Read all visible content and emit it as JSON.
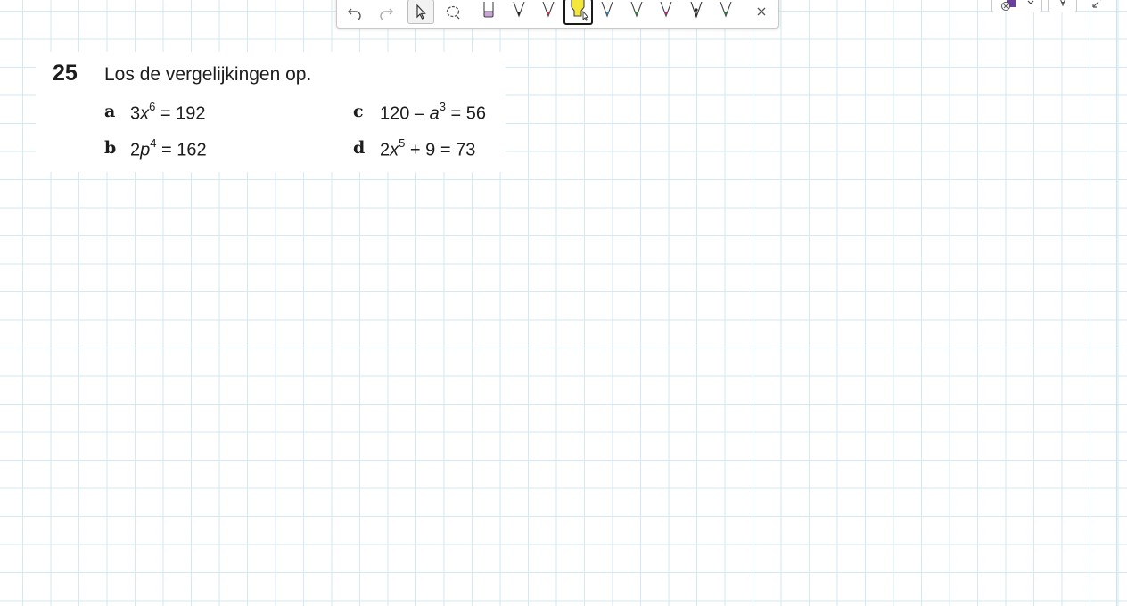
{
  "toolbar": {
    "tools": [
      {
        "name": "undo-icon"
      },
      {
        "name": "redo-icon"
      },
      {
        "name": "select-pointer-icon",
        "active": true
      },
      {
        "name": "lasso-icon"
      },
      {
        "name": "eraser-icon",
        "color": "#c9a3d9"
      },
      {
        "name": "pen-black-icon",
        "color": "#222222"
      },
      {
        "name": "pen-red-icon",
        "color": "#c8334a"
      },
      {
        "name": "highlighter-yellow-icon",
        "color": "#f5e63a",
        "selected": true
      },
      {
        "name": "pen-blue-icon",
        "color": "#2f7fb8"
      },
      {
        "name": "pen-green-icon",
        "color": "#2e8b3e"
      },
      {
        "name": "pen-magenta-icon",
        "color": "#b0288f"
      },
      {
        "name": "fountain-pen-icon",
        "color": "#222222"
      },
      {
        "name": "pen-darkgreen-icon",
        "color": "#2c7a46"
      },
      {
        "name": "close-icon"
      }
    ]
  },
  "exercise": {
    "number": "25",
    "instruction": "Los de vergelijkingen op.",
    "parts": [
      {
        "letter": "a",
        "coef": "3",
        "var": "x",
        "exp": "6",
        "rest": " = 192"
      },
      {
        "letter": "b",
        "coef": "2",
        "var": "p",
        "exp": "4",
        "rest": " = 162"
      },
      {
        "letter": "c",
        "pre": "120 – ",
        "var": "a",
        "exp": "3",
        "rest": " = 56"
      },
      {
        "letter": "d",
        "coef": "2",
        "var": "x",
        "exp": "5",
        "rest": " + 9 = 73"
      }
    ]
  },
  "colors": {
    "grid_line": "#d3e9f3",
    "text": "#1d1d1d"
  }
}
